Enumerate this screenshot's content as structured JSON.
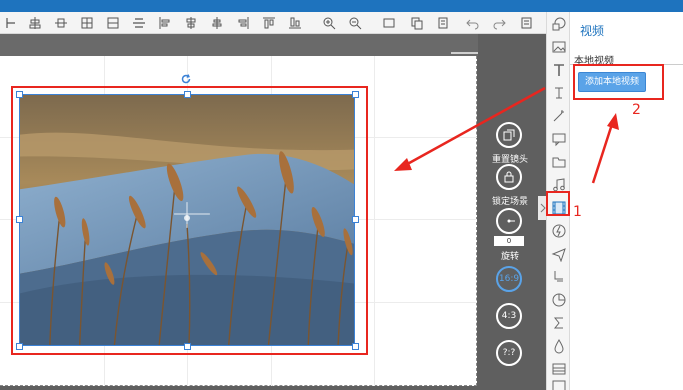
{
  "right_panel": {
    "title": "视频",
    "tab_label": "本地视频",
    "add_button_label": "添加本地视频"
  },
  "side_controls": {
    "reset_label": "重置镜头",
    "lock_label": "锁定场景",
    "rotate_label": "旋转",
    "rotate_value": "0",
    "ratio_16_9": "16:9",
    "ratio_4_3": "4:3",
    "ratio_custom": "?:?"
  },
  "annotations": {
    "step1": "1",
    "step2": "2"
  },
  "colors": {
    "accent": "#1e73be",
    "annotation_red": "#e8261f",
    "button_blue": "#5aa3e8",
    "workspace_gray": "#5f5f5f"
  },
  "toolbar_icons": [
    "ruler-icon",
    "align-center-icon",
    "align-middle-icon",
    "distribute-icon",
    "grid-icon",
    "align-top-icon",
    "align-left-icon",
    "align-center-horizontal-icon",
    "align-right-icon",
    "align-bottom-icon",
    "align-vertical-center-icon",
    "zoom-in-icon",
    "zoom-out-icon",
    "fit-icon",
    "copy-icon",
    "paste-icon",
    "undo-icon",
    "redo-icon",
    "settings-icon"
  ],
  "side_icons": [
    "shape-icon",
    "image-icon",
    "text-icon",
    "formula-icon",
    "magic-wand-icon",
    "comment-icon",
    "folder-icon",
    "music-icon",
    "video-icon",
    "flash-icon",
    "plane-icon",
    "paint-icon",
    "chart-icon",
    "sigma-icon",
    "drop-icon",
    "table-icon",
    "picture-icon"
  ]
}
